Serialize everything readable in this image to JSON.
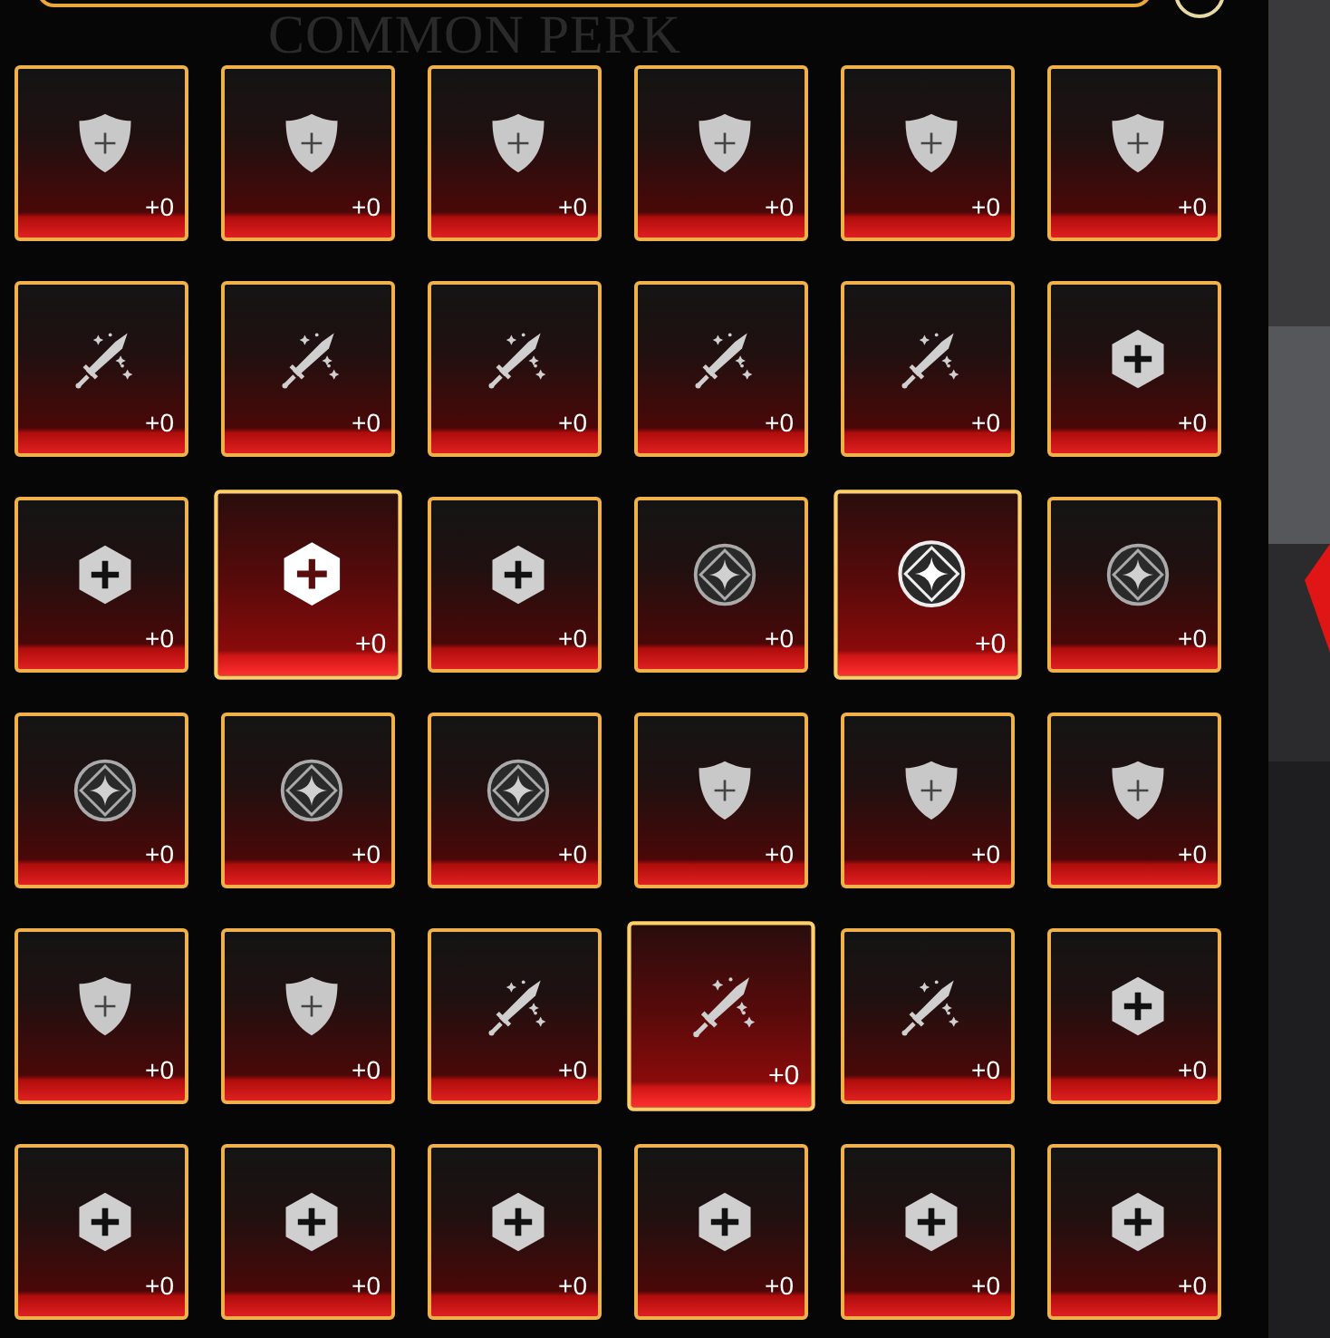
{
  "heading": "COMMON PERK",
  "tiles": [
    {
      "kind": "shield",
      "count": "+0",
      "selected": false
    },
    {
      "kind": "shield",
      "count": "+0",
      "selected": false
    },
    {
      "kind": "shield",
      "count": "+0",
      "selected": false
    },
    {
      "kind": "shield",
      "count": "+0",
      "selected": false
    },
    {
      "kind": "shield",
      "count": "+0",
      "selected": false
    },
    {
      "kind": "shield",
      "count": "+0",
      "selected": false
    },
    {
      "kind": "sword",
      "count": "+0",
      "selected": false
    },
    {
      "kind": "sword",
      "count": "+0",
      "selected": false
    },
    {
      "kind": "sword",
      "count": "+0",
      "selected": false
    },
    {
      "kind": "sword",
      "count": "+0",
      "selected": false
    },
    {
      "kind": "sword",
      "count": "+0",
      "selected": false
    },
    {
      "kind": "hex",
      "count": "+0",
      "selected": false
    },
    {
      "kind": "hex",
      "count": "+0",
      "selected": false
    },
    {
      "kind": "hex",
      "count": "+0",
      "selected": true
    },
    {
      "kind": "hex",
      "count": "+0",
      "selected": false
    },
    {
      "kind": "star",
      "count": "+0",
      "selected": false
    },
    {
      "kind": "star",
      "count": "+0",
      "selected": true
    },
    {
      "kind": "star",
      "count": "+0",
      "selected": false
    },
    {
      "kind": "star",
      "count": "+0",
      "selected": false
    },
    {
      "kind": "star",
      "count": "+0",
      "selected": false
    },
    {
      "kind": "star",
      "count": "+0",
      "selected": false
    },
    {
      "kind": "shield",
      "count": "+0",
      "selected": false
    },
    {
      "kind": "shield",
      "count": "+0",
      "selected": false
    },
    {
      "kind": "shield",
      "count": "+0",
      "selected": false
    },
    {
      "kind": "shield",
      "count": "+0",
      "selected": false
    },
    {
      "kind": "shield",
      "count": "+0",
      "selected": false
    },
    {
      "kind": "sword",
      "count": "+0",
      "selected": false
    },
    {
      "kind": "sword",
      "count": "+0",
      "selected": true
    },
    {
      "kind": "sword",
      "count": "+0",
      "selected": false
    },
    {
      "kind": "hex",
      "count": "+0",
      "selected": false
    },
    {
      "kind": "hex",
      "count": "+0",
      "selected": false
    },
    {
      "kind": "hex",
      "count": "+0",
      "selected": false
    },
    {
      "kind": "hex",
      "count": "+0",
      "selected": false
    },
    {
      "kind": "hex",
      "count": "+0",
      "selected": false
    },
    {
      "kind": "hex",
      "count": "+0",
      "selected": false
    },
    {
      "kind": "hex",
      "count": "+0",
      "selected": false
    }
  ]
}
